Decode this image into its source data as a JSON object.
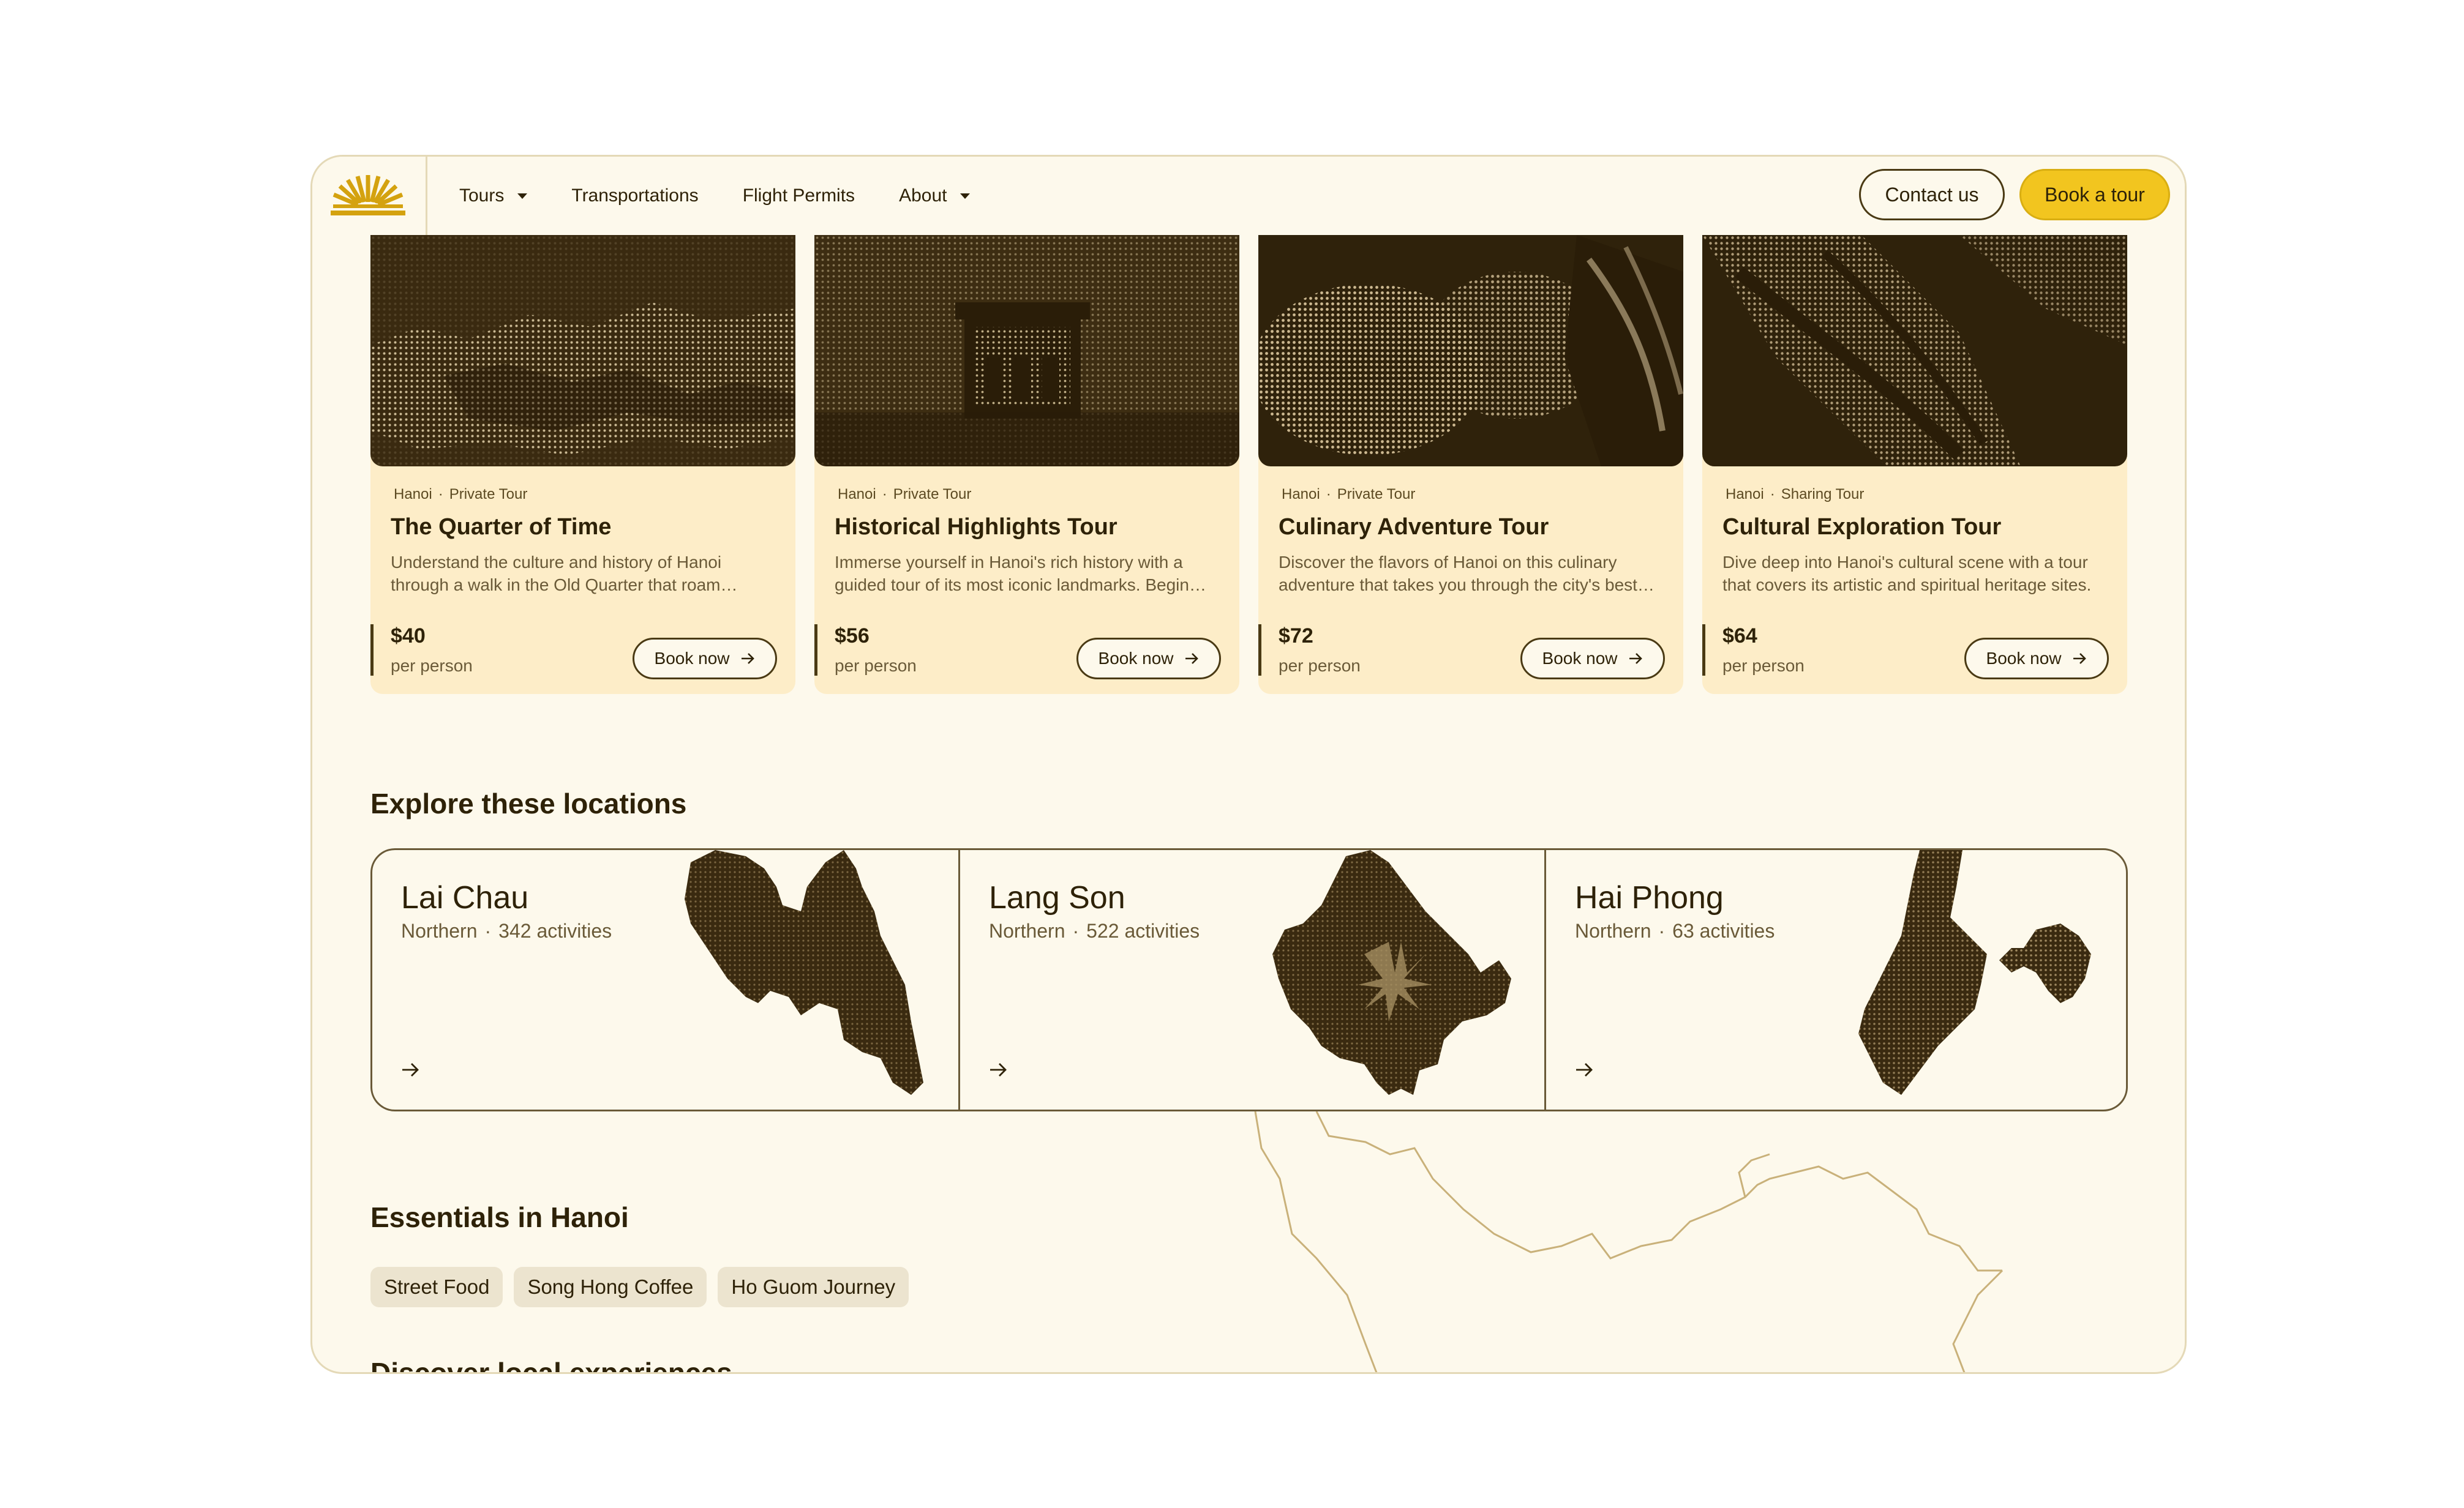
{
  "colors": {
    "background": "#fdf9ec",
    "card": "#fdedc8",
    "accent": "#f2c51f",
    "ink": "#2e2208",
    "muted": "#6a5a38",
    "chip": "#ece4cf"
  },
  "header": {
    "logo": "sunrise-logo-icon",
    "nav": [
      {
        "label": "Tours",
        "has_dropdown": true
      },
      {
        "label": "Transportations",
        "has_dropdown": false
      },
      {
        "label": "Flight Permits",
        "has_dropdown": false
      },
      {
        "label": "About",
        "has_dropdown": true
      }
    ],
    "contact_label": "Contact us",
    "book_label": "Book a tour"
  },
  "tours": [
    {
      "city": "Hanoi",
      "type": "Private Tour",
      "title": "The Quarter of Time",
      "description": "Understand the culture and history of Hanoi through a walk in the Old Quarter that roam through its most beautiful streets.",
      "price": "$40",
      "per": "per person",
      "cta": "Book now"
    },
    {
      "city": "Hanoi",
      "type": "Private Tour",
      "title": "Historical Highlights Tour",
      "description": "Immerse yourself in Hanoi's rich history with a guided tour of its most iconic landmarks. Begin your journey today.",
      "price": "$56",
      "per": "per person",
      "cta": "Book now"
    },
    {
      "city": "Hanoi",
      "type": "Private Tour",
      "title": "Culinary Adventure Tour",
      "description": "Discover the flavors of Hanoi on this culinary adventure that takes you through the city's best street food stalls.",
      "price": "$72",
      "per": "per person",
      "cta": "Book now"
    },
    {
      "city": "Hanoi",
      "type": "Sharing Tour",
      "title": "Cultural Exploration Tour",
      "description": "Dive deep into Hanoi's cultural scene with a tour that covers its artistic and spiritual heritage sites.",
      "price": "$64",
      "per": "per person",
      "cta": "Book now"
    }
  ],
  "locations_section": {
    "title": "Explore these locations",
    "items": [
      {
        "name": "Lai Chau",
        "region": "Northern",
        "activities": "342 activities"
      },
      {
        "name": "Lang Son",
        "region": "Northern",
        "activities": "522 activities"
      },
      {
        "name": "Hai Phong",
        "region": "Northern",
        "activities": "63 activities"
      }
    ]
  },
  "essentials": {
    "title": "Essentials in Hanoi",
    "chips": [
      "Street Food",
      "Song Hong Coffee",
      "Ho Guom Journey"
    ]
  },
  "next_section_title": "Discover local experiences"
}
